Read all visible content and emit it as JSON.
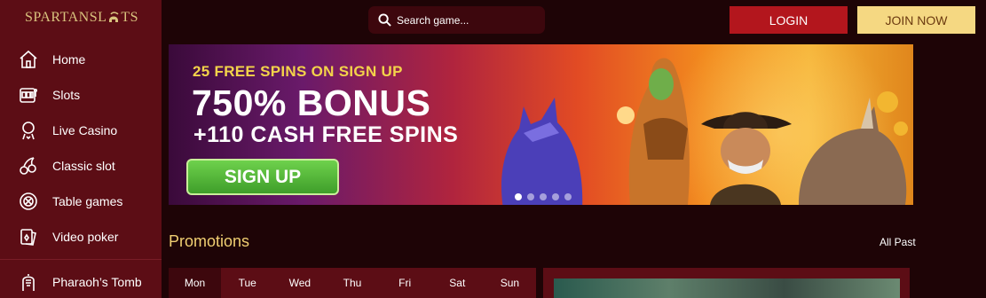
{
  "brand": {
    "logo_left": "SPARTAN",
    "logo_right": "SL",
    "logo_tail": "TS"
  },
  "sidebar": {
    "items": [
      {
        "label": "Home",
        "icon": "home-icon"
      },
      {
        "label": "Slots",
        "icon": "slot-machine-icon"
      },
      {
        "label": "Live Casino",
        "icon": "dealer-icon"
      },
      {
        "label": "Classic slot",
        "icon": "cherries-icon"
      },
      {
        "label": "Table games",
        "icon": "chip-icon"
      },
      {
        "label": "Video poker",
        "icon": "cards-icon"
      }
    ],
    "bottom_item": {
      "label": "Pharaoh’s Tomb",
      "icon": "pharaoh-icon"
    }
  },
  "header": {
    "search_placeholder": "Search game...",
    "login_label": "LOGIN",
    "join_label": "JOIN NOW"
  },
  "banner": {
    "subtitle": "25 FREE SPINS ON SIGN UP",
    "headline": "750% BONUS",
    "cash_line": "+110 CASH FREE SPINS",
    "signup_label": "SIGN UP",
    "slides": 5,
    "active_slide": 1
  },
  "promotions": {
    "title": "Promotions",
    "filter_label": "All Past",
    "days": [
      "Mon",
      "Tue",
      "Wed",
      "Thu",
      "Fri",
      "Sat",
      "Sun"
    ],
    "active_day": "Mon"
  },
  "colors": {
    "background": "#1e0406",
    "sidebar": "#5c0d15",
    "login": "#b3161d",
    "join": "#f5d882",
    "accent_gold": "#f0cf72",
    "signup_green": "#4fb334"
  }
}
